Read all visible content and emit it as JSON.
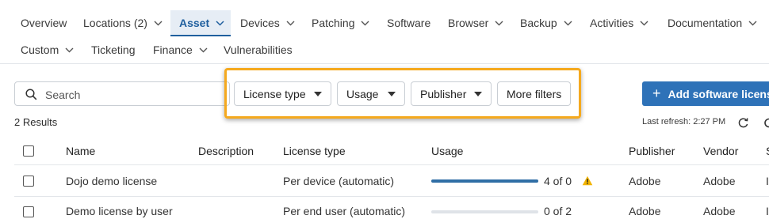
{
  "nav": {
    "row1": [
      {
        "label": "Overview",
        "chevron": false
      },
      {
        "label": "Locations (2)",
        "chevron": true
      },
      {
        "label": "Asset",
        "chevron": true,
        "active": true
      },
      {
        "label": "Devices",
        "chevron": true
      },
      {
        "label": "Patching",
        "chevron": true
      },
      {
        "label": "Software",
        "chevron": false
      },
      {
        "label": "Browser",
        "chevron": true
      },
      {
        "label": "Backup",
        "chevron": true
      },
      {
        "label": "Activities",
        "chevron": true
      },
      {
        "label": "Documentation",
        "chevron": true
      }
    ],
    "row2": [
      {
        "label": "Custom",
        "chevron": true
      },
      {
        "label": "Ticketing",
        "chevron": false
      },
      {
        "label": "Finance",
        "chevron": true
      },
      {
        "label": "Vulnerabilities",
        "chevron": false
      }
    ]
  },
  "search": {
    "placeholder": "Search"
  },
  "filters": {
    "license_type": "License type",
    "usage": "Usage",
    "publisher": "Publisher",
    "more": "More filters"
  },
  "add_button": "Add software license",
  "results": "2 Results",
  "last_refresh": "Last refresh: 2:27 PM",
  "table": {
    "headers": {
      "name": "Name",
      "description": "Description",
      "license_type": "License type",
      "usage": "Usage",
      "publisher": "Publisher",
      "vendor": "Vendor",
      "extra": "S"
    },
    "rows": [
      {
        "name": "Dojo demo license",
        "description": "",
        "license_type": "Per device (automatic)",
        "usage": "4 of 0",
        "usage_fraction": 1.0,
        "warning": true,
        "publisher": "Adobe",
        "vendor": "Adobe",
        "extra": "I"
      },
      {
        "name": "Demo license by user",
        "description": "",
        "license_type": "Per end user (automatic)",
        "usage": "0 of 2",
        "usage_fraction": 0.0,
        "warning": false,
        "publisher": "Adobe",
        "vendor": "Adobe",
        "extra": "I"
      }
    ]
  },
  "colors": {
    "accent": "#2e72b8",
    "active_tab_bg": "#e6edf5",
    "highlight": "#f5a91e",
    "warning": "#f2b400"
  }
}
